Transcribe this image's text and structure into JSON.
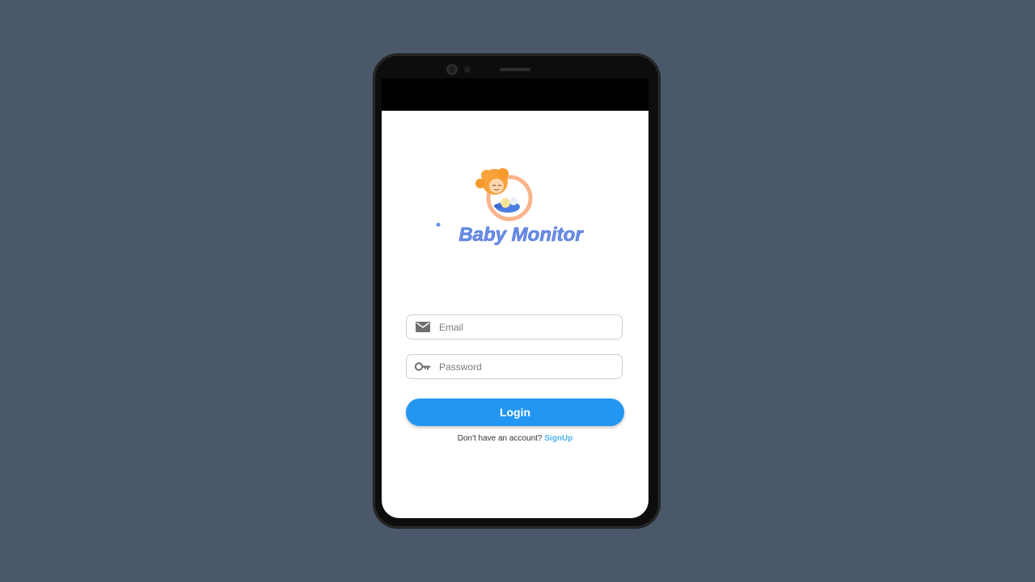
{
  "app": {
    "name": "Baby Monitor"
  },
  "login_form": {
    "email_placeholder": "Email",
    "password_placeholder": "Password",
    "login_label": "Login"
  },
  "signup": {
    "prompt": "Don't have an account?",
    "link_label": "SignUp"
  },
  "icons": {
    "email": "mail-icon",
    "password": "key-icon"
  },
  "colors": {
    "background": "#4a5869",
    "accent": "#2196f3",
    "link": "#4fb3f0",
    "logo_text": "#6b8fe8",
    "logo_hair": "#f7a33a"
  }
}
